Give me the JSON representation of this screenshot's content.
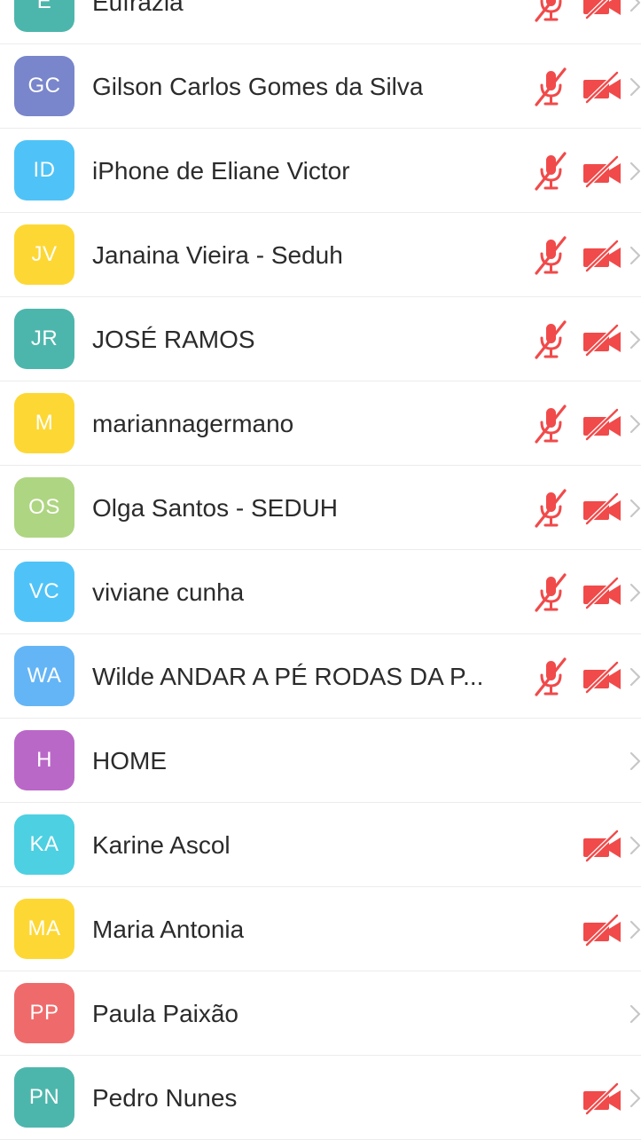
{
  "participants": [
    {
      "initials": "E",
      "name": "Eufrázia",
      "color": "#4db6ac",
      "audio_muted": true,
      "video_off": true
    },
    {
      "initials": "GC",
      "name": "Gilson Carlos Gomes da Silva",
      "color": "#7986cb",
      "audio_muted": true,
      "video_off": true
    },
    {
      "initials": "ID",
      "name": "iPhone de Eliane Victor",
      "color": "#4fc3f7",
      "audio_muted": true,
      "video_off": true
    },
    {
      "initials": "JV",
      "name": "Janaina Vieira - Seduh",
      "color": "#fdd835",
      "audio_muted": true,
      "video_off": true
    },
    {
      "initials": "JR",
      "name": "JOSÉ RAMOS",
      "color": "#4db6ac",
      "audio_muted": true,
      "video_off": true
    },
    {
      "initials": "M",
      "name": "mariannagermano",
      "color": "#fdd835",
      "audio_muted": true,
      "video_off": true
    },
    {
      "initials": "OS",
      "name": "Olga Santos - SEDUH",
      "color": "#aed581",
      "audio_muted": true,
      "video_off": true
    },
    {
      "initials": "VC",
      "name": "viviane cunha",
      "color": "#4fc3f7",
      "audio_muted": true,
      "video_off": true
    },
    {
      "initials": "WA",
      "name": "Wilde ANDAR A PÉ RODAS DA P...",
      "color": "#64b5f6",
      "audio_muted": true,
      "video_off": true
    },
    {
      "initials": "H",
      "name": "HOME",
      "color": "#ba68c8",
      "audio_muted": false,
      "video_off": false
    },
    {
      "initials": "KA",
      "name": "Karine Ascol",
      "color": "#4dd0e1",
      "audio_muted": false,
      "video_off": true
    },
    {
      "initials": "MA",
      "name": "Maria Antonia",
      "color": "#fdd835",
      "audio_muted": false,
      "video_off": true
    },
    {
      "initials": "PP",
      "name": "Paula Paixão",
      "color": "#ef6b6b",
      "audio_muted": false,
      "video_off": false
    },
    {
      "initials": "PN",
      "name": "Pedro Nunes",
      "color": "#4db6ac",
      "audio_muted": false,
      "video_off": true
    }
  ],
  "icons": {
    "muted_mic": "mic-muted-icon",
    "video_off": "video-off-icon",
    "chevron": "chevron-right-icon"
  },
  "colors": {
    "alert_red": "#f14a4a",
    "chevron_gray": "#c7c7c7"
  }
}
